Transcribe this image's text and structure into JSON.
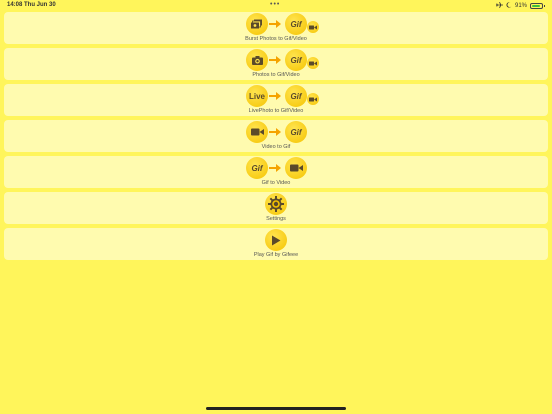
{
  "status": {
    "time": "14:08",
    "date": "Thu Jun 30",
    "dots": "•••",
    "battery": "91%",
    "battery_level": 0.91
  },
  "menu": {
    "items": [
      {
        "label": "Burst Photos to Gif/Video",
        "from_icon": "burst-photos-icon",
        "to_icon": "gif-icon",
        "extra_icon": "video-camera-icon"
      },
      {
        "label": "Photos to Gif/Video",
        "from_icon": "camera-icon",
        "to_icon": "gif-icon",
        "extra_icon": "video-camera-icon"
      },
      {
        "label": "LivePhoto to Gif/Video",
        "from_icon": "live-photo-icon",
        "to_icon": "gif-icon",
        "extra_icon": "video-camera-icon"
      },
      {
        "label": "Video to Gif",
        "from_icon": "video-camera-icon",
        "to_icon": "gif-icon"
      },
      {
        "label": "Gif to Video",
        "from_icon": "gif-icon",
        "to_icon": "video-camera-icon"
      },
      {
        "label": "Settings",
        "icon": "gear-icon"
      },
      {
        "label": "Play Gif by Gifeee",
        "icon": "play-icon"
      }
    ],
    "gif_text": "Gif",
    "live_text": "Live"
  },
  "colors": {
    "background": "#FFF55B",
    "card": "#FFFBAF",
    "icon_circle": "#F5C300",
    "arrow": "#F5A300"
  }
}
